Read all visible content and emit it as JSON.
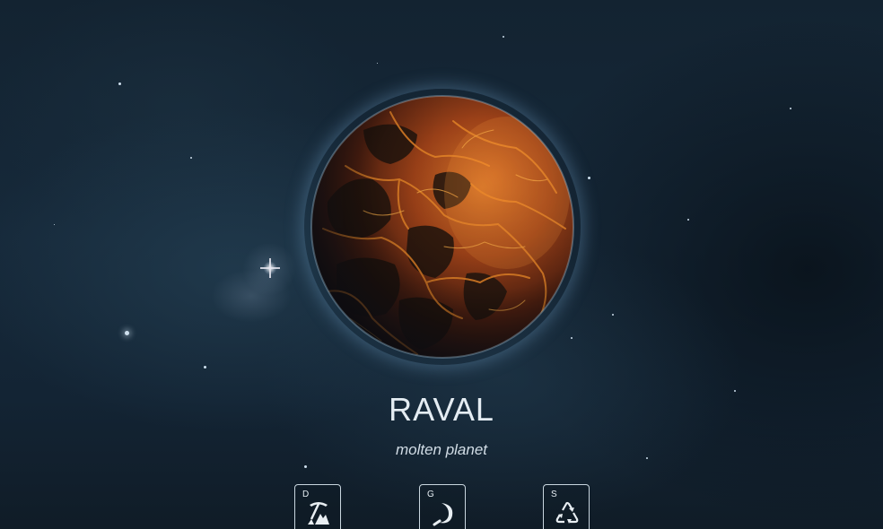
{
  "planet": {
    "name": "RAVAL",
    "type": "molten planet"
  },
  "actions": [
    {
      "key": "D",
      "icon": "mining-pickaxe-icon"
    },
    {
      "key": "G",
      "icon": "harvest-sickle-icon"
    },
    {
      "key": "S",
      "icon": "recycle-icon"
    }
  ],
  "colors": {
    "lava_bright": "#f08a2a",
    "lava_deep": "#8a2c0c",
    "crust_dark": "#1c1412",
    "space_bg": "#132331",
    "text": "#e4ecf2"
  }
}
